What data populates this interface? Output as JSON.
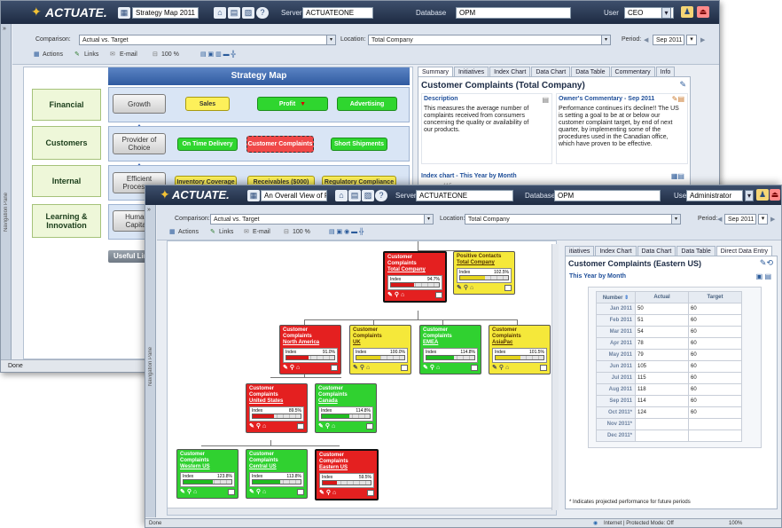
{
  "back_window": {
    "logo": "ACTUATE.",
    "report_select": "Strategy Map 2011",
    "server_label": "Server",
    "server_value": "ACTUATEONE",
    "database_label": "Database",
    "database_value": "OPM",
    "user_label": "User",
    "user_value": "CEO",
    "comparison_label": "Comparison:",
    "comparison_value": "Actual vs. Target",
    "location_label": "Location:",
    "location_value": "Total Company",
    "period_label": "Period:",
    "period_value": "Sep 2011",
    "toolbar": {
      "actions": "Actions",
      "links": "Links",
      "email": "E-mail",
      "zoom": "100 %"
    },
    "nav_pane": "Navigation Pane",
    "strategy_map_title": "Strategy Map",
    "perspectives": [
      "Financial",
      "Customers",
      "Internal",
      "Learning & Innovation"
    ],
    "objectives": {
      "growth": "Growth",
      "sales": "Sales",
      "profit": "Profit",
      "advertising": "Advertising",
      "provider_of_choice": "Provider of Choice",
      "on_time_delivery": "On Time Delivery",
      "customer_complaints": "Customer Complaints",
      "short_shipments": "Short Shipments",
      "efficient_processes": "Efficient Processes",
      "inventory_coverage": "Inventory Coverage",
      "receivables": "Receivables ($000)",
      "regulatory_compliance": "Regulatory Compliance",
      "human_capital": "Human Capital"
    },
    "useful_links": "Useful Lin",
    "tabs": [
      "Summary",
      "Initiatives",
      "Index Chart",
      "Data Chart",
      "Data Table",
      "Commentary",
      "Info"
    ],
    "panel_title": "Customer Complaints (Total Company)",
    "description_title": "Description",
    "description_text": "This measures the average number of complaints received from consumers concerning the quality or availability of our products.",
    "commentary_title": "Owner's Commentary - Sep 2011",
    "commentary_text": "Performance continues it's decline!! The US is setting a goal to be at or below our customer complaint target, by end of next quarter, by implementing some of the procedures used in the Canadian office, which have proven to be effective.",
    "index_chart_title": "Index chart - This Year by Month",
    "index_chart_value": "115",
    "status": "Done"
  },
  "front_window": {
    "logo": "ACTUATE.",
    "report_select": "An Overall View of Perfor",
    "server_label": "Server",
    "server_value": "ACTUATEONE",
    "database_label": "Database",
    "database_value": "OPM",
    "user_label": "User",
    "user_value": "Administrator",
    "comparison_label": "Comparison:",
    "comparison_value": "Actual vs. Target",
    "location_label": "Location:",
    "location_value": "Total Company",
    "period_label": "Period:",
    "period_value": "Sep 2011",
    "toolbar": {
      "actions": "Actions",
      "links": "Links",
      "email": "E-mail",
      "zoom": "100 %"
    },
    "nav_pane": "Navigation Pane",
    "nodes": [
      {
        "title": "Customer Complaints",
        "sub": "Total Company",
        "index_label": "Index",
        "index": "94.7%",
        "fill": 0.48,
        "status": "red"
      },
      {
        "title": "Positive Contacts",
        "sub": "Total Company",
        "index_label": "Index",
        "index": "102.5%",
        "fill": 0.52,
        "status": "yellow"
      },
      {
        "title": "Customer Complaints",
        "sub": "North America",
        "index_label": "Index",
        "index": "91.0%",
        "fill": 0.46,
        "status": "red"
      },
      {
        "title": "Customer Complaints",
        "sub": "UK",
        "index_label": "Index",
        "index": "100.0%",
        "fill": 0.5,
        "status": "yellow"
      },
      {
        "title": "Customer Complaints",
        "sub": "EMEA",
        "index_label": "Index",
        "index": "114.8%",
        "fill": 0.58,
        "status": "green"
      },
      {
        "title": "Customer Complaints",
        "sub": "AsiaPac",
        "index_label": "Index",
        "index": "101.5%",
        "fill": 0.51,
        "status": "yellow"
      },
      {
        "title": "Customer Complaints",
        "sub": "United States",
        "index_label": "Index",
        "index": "89.5%",
        "fill": 0.45,
        "status": "red"
      },
      {
        "title": "Customer Complaints",
        "sub": "Canada",
        "index_label": "Index",
        "index": "114.8%",
        "fill": 0.58,
        "status": "green"
      },
      {
        "title": "Customer Complaints",
        "sub": "Western US",
        "index_label": "Index",
        "index": "123.8%",
        "fill": 0.62,
        "status": "green"
      },
      {
        "title": "Customer Complaints",
        "sub": "Central US",
        "index_label": "Index",
        "index": "113.8%",
        "fill": 0.57,
        "status": "green"
      },
      {
        "title": "Customer Complaints",
        "sub": "Eastern US",
        "index_label": "Index",
        "index": "59.5%",
        "fill": 0.3,
        "status": "red"
      }
    ],
    "tabs": [
      "itiatives",
      "Index Chart",
      "Data Chart",
      "Data Table",
      "Direct Data Entry"
    ],
    "panel_title": "Customer Complaints (Eastern US)",
    "subtitle": "This Year by Month",
    "table_headers": [
      "Number",
      "Actual",
      "Target"
    ],
    "table_rows": [
      [
        "Jan 2011",
        "50",
        "60"
      ],
      [
        "Feb 2011",
        "51",
        "60"
      ],
      [
        "Mar 2011",
        "54",
        "60"
      ],
      [
        "Apr 2011",
        "78",
        "60"
      ],
      [
        "May 2011",
        "79",
        "60"
      ],
      [
        "Jun 2011",
        "105",
        "60"
      ],
      [
        "Jul 2011",
        "115",
        "60"
      ],
      [
        "Aug 2011",
        "118",
        "60"
      ],
      [
        "Sep 2011",
        "114",
        "60"
      ],
      [
        "Oct 2011*",
        "124",
        "60"
      ],
      [
        "Nov 2011*",
        "",
        ""
      ],
      [
        "Dec 2011*",
        "",
        ""
      ]
    ],
    "footnote": "* Indicates projected performance for future periods",
    "status_left": "Done",
    "status_zone": "Internet | Protected Mode: Off",
    "status_zoom": "100%"
  },
  "colors": {
    "red": "#e42020",
    "yellow": "#f5e83a",
    "green": "#30d130",
    "brand_bar": "#2b3b58",
    "map_blue": "#3d68b5"
  }
}
